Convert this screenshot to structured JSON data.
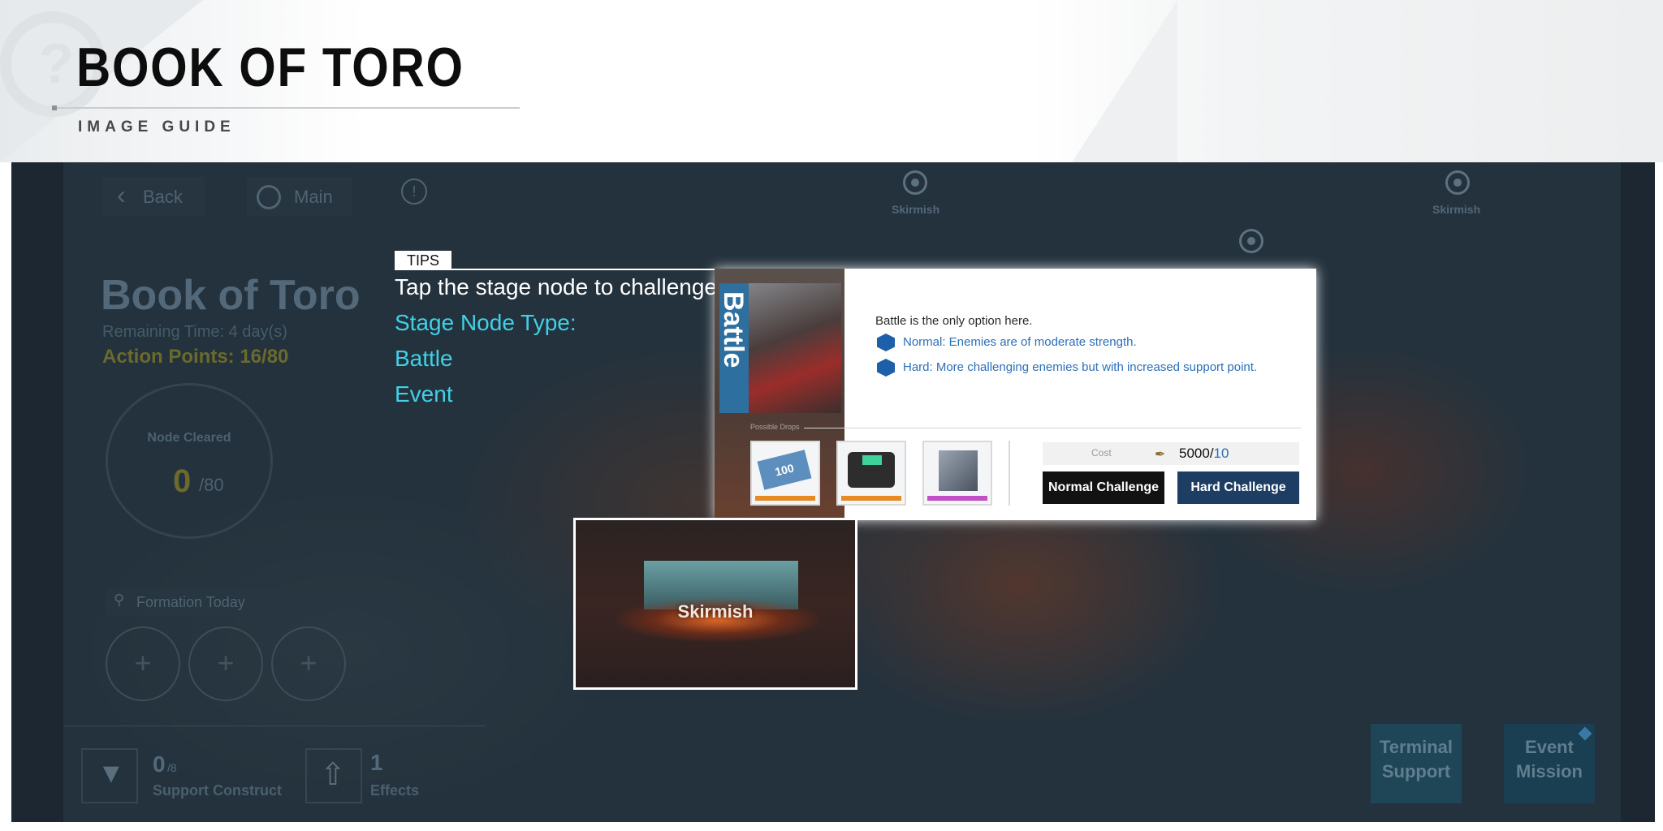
{
  "guide": {
    "title": "BOOK OF TORO",
    "subtitle": "IMAGE GUIDE"
  },
  "hud": {
    "back_label": "Back",
    "main_label": "Main",
    "info_icon": "!"
  },
  "event_panel": {
    "title": "Book of Toro",
    "remaining_time": "Remaining Time: 4 day(s)",
    "action_points": "Action Points: 16/80",
    "node_cleared_label": "Node Cleared",
    "node_cleared_value": "0",
    "node_cleared_total": "/80",
    "formation_label": "Formation Today",
    "formation_slot_glyph": "+"
  },
  "map_nodes": {
    "skirmish_1": "Skirmish",
    "skirmish_2": "Skirmish"
  },
  "tips": {
    "badge": "TIPS",
    "line1": "Tap the stage node to challenge.",
    "line2": "Stage Node Type:",
    "line3": "Battle",
    "line4": "Event"
  },
  "battle_card": {
    "vertical_label": "Battle",
    "description": "Battle is the only option here.",
    "normal_desc": "Normal: Enemies are of moderate strength.",
    "hard_desc": "Hard: More challenging enemies but with increased support point.",
    "drops_label": "Possible Drops",
    "drop_item_1_label": "100",
    "cost_label": "Cost",
    "cost_current": "5000/",
    "cost_total": "10",
    "normal_button": "Normal Challenge",
    "hard_button": "Hard Challenge"
  },
  "skirmish_card": {
    "label": "Skirmish"
  },
  "bottom_bar": {
    "support_value": "0",
    "support_max": "/8",
    "support_label": "Support Construct",
    "effects_value": "1",
    "effects_label": "Effects",
    "terminal_support": "Terminal Support",
    "event_mission": "Event Mission"
  },
  "colors": {
    "accent_cyan": "#3fd1e6",
    "link_blue": "#2c6fb7",
    "normal_button": "#121212",
    "hard_button": "#1d3d63"
  }
}
